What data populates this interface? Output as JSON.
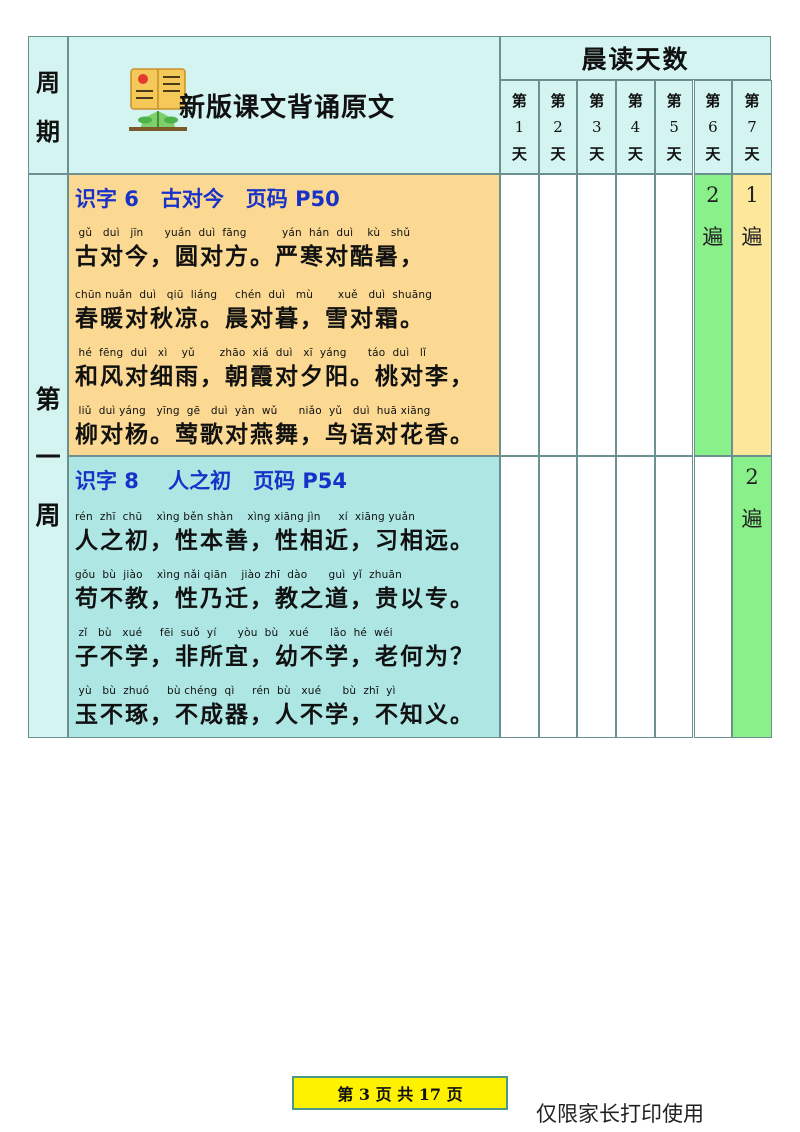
{
  "header": {
    "week_col_label": [
      "周",
      "期"
    ],
    "doc_title": "新版课文背诵原文",
    "morning_reading_label": "晨读天数",
    "day_prefix": "第",
    "day_suffix": "天",
    "days": [
      "1",
      "2",
      "3",
      "4",
      "5",
      "6",
      "7"
    ]
  },
  "week": {
    "label_chars": [
      "第",
      "一",
      "周"
    ]
  },
  "sections": [
    {
      "title": "识字 6   古对今   页码 P50",
      "lines": [
        {
          "pinyin": " gǔ   duì   jīn      yuán  duì  fāng          yán  hán  duì    kù   shǔ",
          "hanzi": "古对今，圆对方。严寒对酷暑，"
        },
        {
          "pinyin": "chūn nuǎn  duì   qiū  liáng     chén  duì   mù       xuě   duì  shuāng",
          "hanzi": "春暖对秋凉。晨对暮，雪对霜。"
        },
        {
          "pinyin": " hé  fēng  duì   xì    yǔ       zhāo  xiá  duì   xī  yáng      táo  duì   lǐ",
          "hanzi": "和风对细雨，朝霞对夕阳。桃对李，"
        },
        {
          "pinyin": " liǔ  duì yáng   yīng  gē   duì  yàn  wǔ      niǎo  yǔ   duì  huā xiāng",
          "hanzi": "柳对杨。莺歌对燕舞，鸟语对花香。"
        }
      ],
      "times": {
        "day6": "2",
        "day7": "1",
        "unit": "遍"
      }
    },
    {
      "title": "识字 8    人之初   页码 P54",
      "lines": [
        {
          "pinyin": "rén  zhī  chū    xìng běn shàn    xìng xiāng jìn     xí  xiāng yuǎn",
          "hanzi": "人之初，性本善，性相近，习相远。"
        },
        {
          "pinyin": "gǒu  bù  jiào    xìng nǎi qiān    jiào zhī  dào      guì  yǐ  zhuān",
          "hanzi": "苟不教，性乃迁，教之道，贵以专。"
        },
        {
          "pinyin": " zǐ   bù   xué     fēi  suǒ  yí      yòu  bù   xué      lǎo  hé  wéi",
          "hanzi": "子不学，非所宜，幼不学，老何为？"
        },
        {
          "pinyin": " yù   bù  zhuó     bù chéng  qì     rén  bù   xué      bù  zhī  yì",
          "hanzi": "玉不琢，不成器，人不学，不知义。"
        }
      ],
      "times": {
        "day7": "2",
        "unit": "遍"
      }
    }
  ],
  "footer": {
    "page_indicator": "第 3 页 共 17 页",
    "note": "仅限家长打印使用"
  },
  "colors": {
    "header_bg": "#d3f4f1",
    "section1_bg": "#fbd993",
    "section2_bg": "#ade6e3",
    "done_green": "#8af08a",
    "done_yellow": "#fde79b",
    "title_blue": "#1832c8",
    "badge_yellow": "#fff200"
  }
}
